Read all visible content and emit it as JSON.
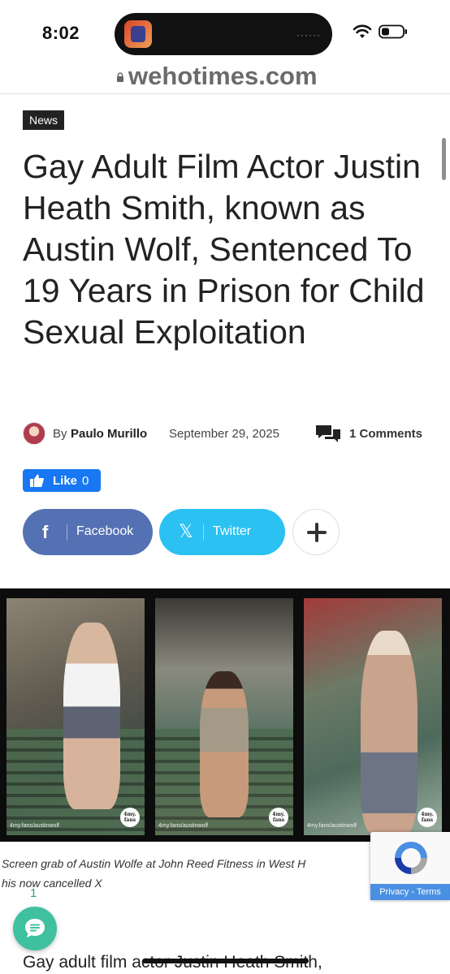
{
  "status_bar": {
    "time": "8:02",
    "island_dots": "······"
  },
  "browser": {
    "url": "wehotimes.com"
  },
  "article": {
    "category": "News",
    "title": "Gay Adult Film Actor Justin Heath Smith, known as Austin Wolf, Sentenced To 19 Years in Prison for Child Sexual Exploitation",
    "by_label": "By",
    "author": "Paulo Murillo",
    "date": "September 29, 2025",
    "comments_label": "1 Comments",
    "caption": "Screen grab of Austin Wolfe at John Reed Fitness in West H\nhis now cancelled X",
    "body_start": "Gay adult film actor Justin Heath Smith,"
  },
  "like_button": {
    "label": "Like",
    "count": "0"
  },
  "share": {
    "facebook_label": "Facebook",
    "twitter_label": "Twitter",
    "facebook_glyph": "f",
    "twitter_glyph": "𝕏"
  },
  "featured_image": {
    "watermarks": [
      "4my.fans/austinwolf",
      "4my.fans/austinwolf",
      "4my.fans/austinwolf"
    ],
    "logo_text": "4my. fans"
  },
  "recaptcha": {
    "links": "Privacy - Terms"
  },
  "floating_comment": {
    "count": "1"
  },
  "colors": {
    "facebook": "#5471b3",
    "twitter": "#2bc1f2",
    "like": "#1877f2",
    "comment_fab": "#3fc1a0"
  }
}
